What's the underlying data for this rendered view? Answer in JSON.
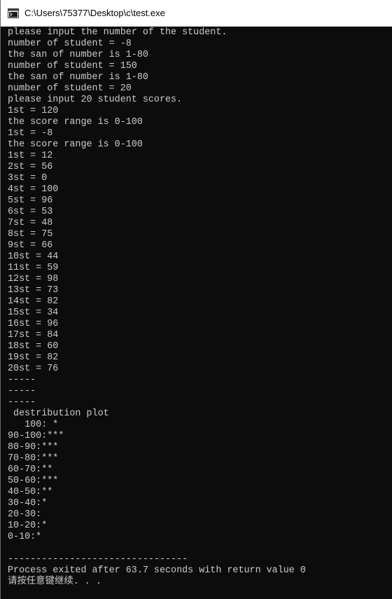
{
  "window": {
    "title": "C:\\Users\\75377\\Desktop\\c\\test.exe",
    "icon": "console-app-icon"
  },
  "console": {
    "lines": [
      "please input the number of the student.",
      "number of student = -8",
      "the san of number is 1-80",
      "number of student = 150",
      "the san of number is 1-80",
      "number of student = 20",
      "please input 20 student scores.",
      "1st = 120",
      "the score range is 0-100",
      "1st = -8",
      "the score range is 0-100",
      "1st = 12",
      "2st = 56",
      "3st = 0",
      "4st = 100",
      "5st = 96",
      "6st = 53",
      "7st = 48",
      "8st = 75",
      "9st = 66",
      "10st = 44",
      "11st = 59",
      "12st = 98",
      "13st = 73",
      "14st = 82",
      "15st = 34",
      "16st = 96",
      "17st = 84",
      "18st = 60",
      "19st = 82",
      "20st = 76",
      "-----",
      "-----",
      "-----",
      " destribution plot",
      "   100: *",
      "90-100:***",
      "80-90:***",
      "70-80:***",
      "60-70:**",
      "50-60:***",
      "40-50:**",
      "30-40:*",
      "20-30:",
      "10-20:*",
      "0-10:*",
      "",
      "--------------------------------",
      "Process exited after 63.7 seconds with return value 0",
      "请按任意键继续. . ."
    ]
  }
}
